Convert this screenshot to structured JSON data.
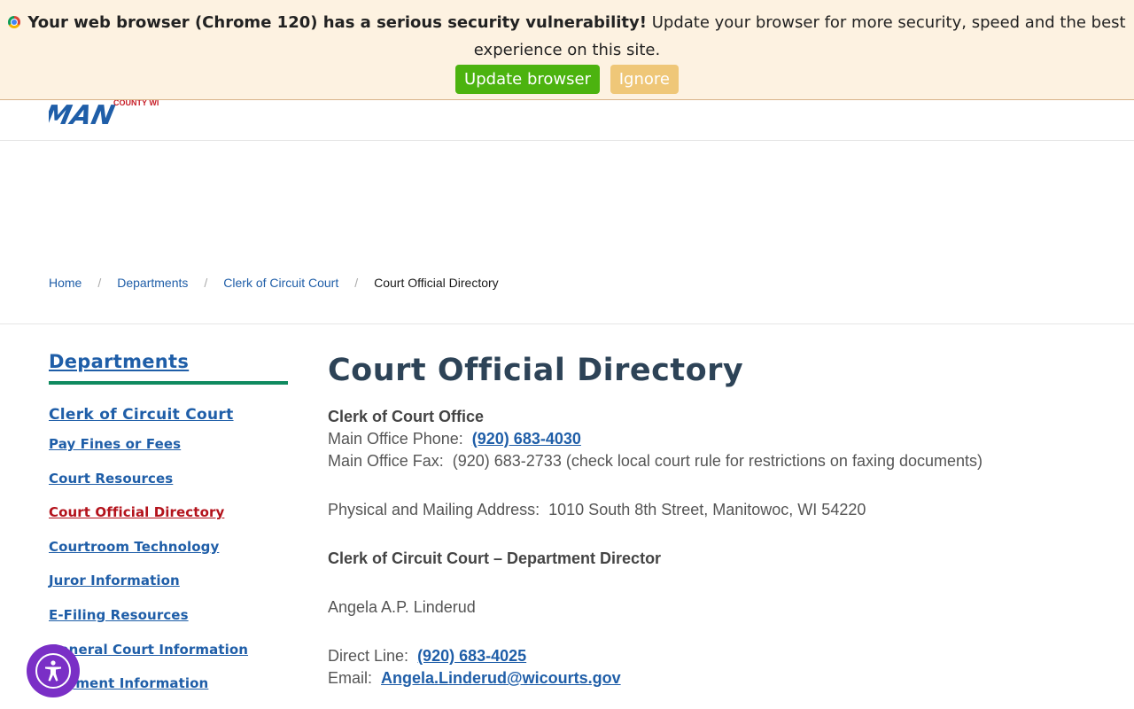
{
  "banner": {
    "strong": "Your web browser (Chrome 120) has a serious security vulnerability!",
    "rest": "Update your browser for more security, speed and the best experience on this site.",
    "update_label": "Update browser",
    "ignore_label": "Ignore"
  },
  "logo": {
    "line1": "MAN",
    "line2": "COUNTY WI"
  },
  "breadcrumb": {
    "items": [
      "Home",
      "Departments",
      "Clerk of Circuit Court"
    ],
    "current": "Court Official Directory",
    "separator": "/"
  },
  "sidebar": {
    "title": "Departments",
    "section": "Clerk of Circuit Court",
    "items": [
      {
        "label": "Pay Fines or Fees"
      },
      {
        "label": "Court Resources"
      },
      {
        "label": "Court Official Directory",
        "active": true
      },
      {
        "label": "Courtroom Technology"
      },
      {
        "label": "Juror Information"
      },
      {
        "label": "E-Filing Resources"
      },
      {
        "label": "General Court Information"
      },
      {
        "label": "Payment Information"
      }
    ]
  },
  "main": {
    "title": "Court Official Directory",
    "office_heading": "Clerk of Court Office",
    "phone_label": "Main Office Phone:",
    "phone": "(920) 683-4030",
    "fax_label": "Main Office Fax:",
    "fax": "(920) 683-2733 (check local court rule for restrictions on faxing documents)",
    "address_label": "Physical and Mailing Address:",
    "address": "1010 South 8th Street, Manitowoc, WI 54220",
    "director_heading": "Clerk of Circuit Court – Department Director",
    "director_name": "Angela A.P. Linderud",
    "direct_label": "Direct Line:",
    "direct_phone": "(920) 683-4025",
    "email_label": "Email:",
    "email": "Angela.Linderud@wicourts.gov"
  },
  "colors": {
    "link": "#1f5ea8",
    "active_link": "#b3121b",
    "accent_rule": "#0f8a5f",
    "title": "#2d4357",
    "banner_bg": "#fdf2e1",
    "update_btn": "#4cb30f",
    "ignore_btn": "#efc778",
    "a11y": "#7a2fc6"
  },
  "icons": {
    "browser": "chrome-icon",
    "accessibility": "accessibility-icon"
  }
}
